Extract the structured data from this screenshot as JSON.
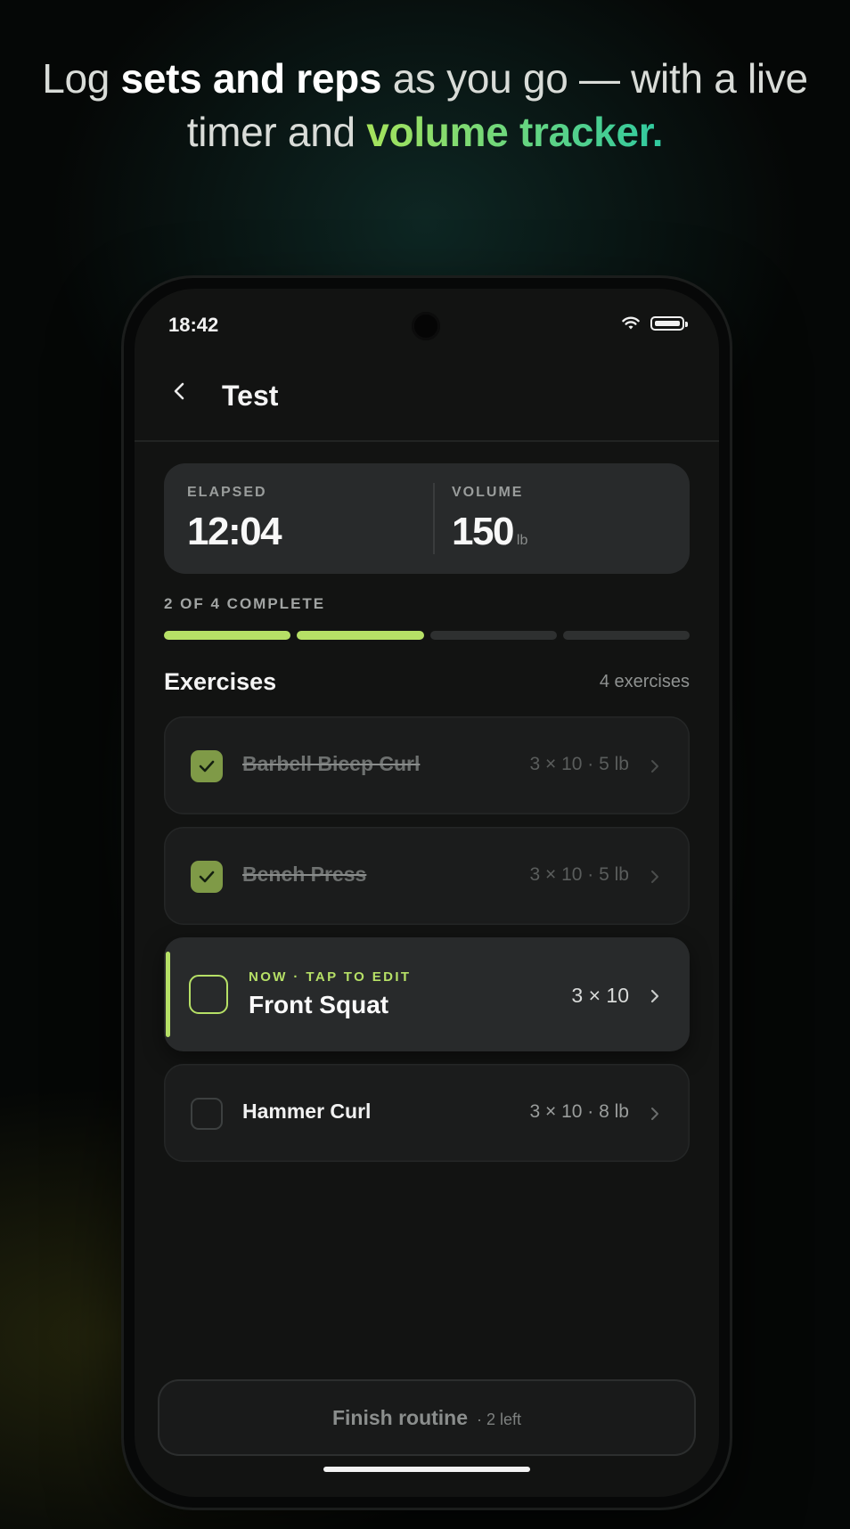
{
  "headline": {
    "part1": "Log ",
    "bold": "sets and reps",
    "part2": " as you go — with a live timer and ",
    "accent": "volume tracker."
  },
  "status_bar": {
    "time": "18:42"
  },
  "header": {
    "title": "Test"
  },
  "stats": {
    "elapsed_label": "ELAPSED",
    "elapsed_value": "12:04",
    "volume_label": "VOLUME",
    "volume_value": "150",
    "volume_unit": "lb"
  },
  "progress": {
    "label": "2 OF 4 COMPLETE",
    "completed": 2,
    "total": 4
  },
  "exercises_section": {
    "title": "Exercises",
    "count": "4 exercises"
  },
  "exercises": [
    {
      "name": "Barbell Bicep Curl",
      "meta": "3 × 10 · 5 lb",
      "state": "done"
    },
    {
      "name": "Bench Press",
      "meta": "3 × 10 · 5 lb",
      "state": "done"
    },
    {
      "name": "Front Squat",
      "meta": "3 × 10",
      "state": "current",
      "tag": "NOW · TAP TO EDIT"
    },
    {
      "name": "Hammer Curl",
      "meta": "3 × 10 · 8 lb",
      "state": "todo"
    }
  ],
  "finish": {
    "label": "Finish routine",
    "remaining": "· 2 left"
  },
  "colors": {
    "accent": "#b6e066",
    "done_check": "#7f9a47",
    "card": "#282a2b"
  }
}
